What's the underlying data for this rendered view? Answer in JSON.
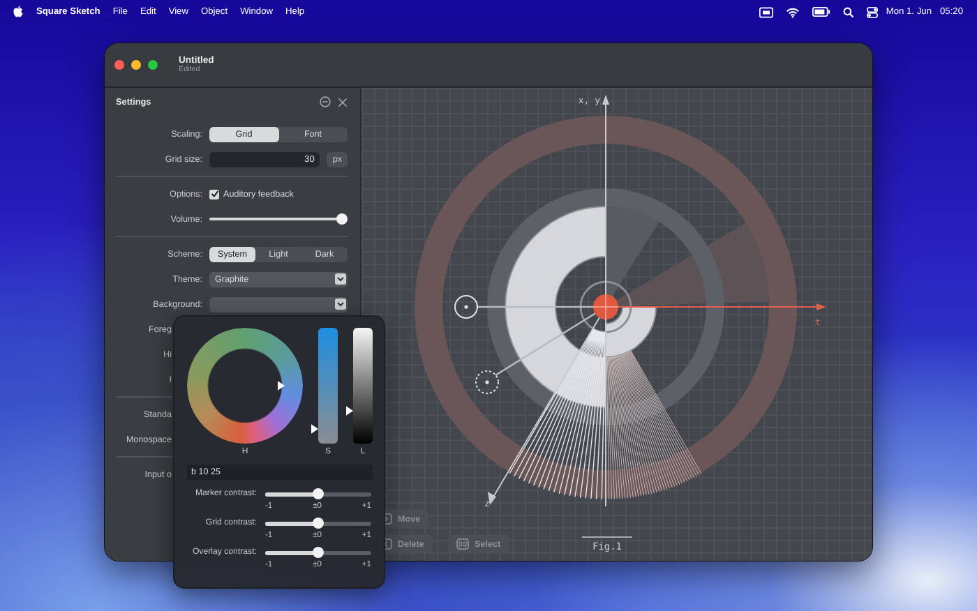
{
  "menu_bar": {
    "app_name": "Square Sketch",
    "menus": [
      "File",
      "Edit",
      "View",
      "Object",
      "Window",
      "Help"
    ],
    "date": "Mon 1. Jun",
    "time": "05:20"
  },
  "window": {
    "title": "Untitled",
    "subtitle": "Edited"
  },
  "settings": {
    "title": "Settings",
    "groups": [
      [
        {
          "kind": "segmented",
          "label": "Scaling:",
          "options": [
            {
              "label": "Grid",
              "selected": true
            },
            {
              "label": "Font",
              "selected": false
            }
          ]
        },
        {
          "kind": "number",
          "label": "Grid size:",
          "value": "30",
          "unit": "px"
        }
      ],
      [
        {
          "kind": "checkbox",
          "label": "Options:",
          "text": "Auditory feedback",
          "checked": true
        },
        {
          "kind": "slider",
          "label": "Volume:",
          "level": 1.0
        }
      ],
      [
        {
          "kind": "segmented",
          "label": "Scheme:",
          "options": [
            {
              "label": "System",
              "selected": true
            },
            {
              "label": "Light",
              "selected": false
            },
            {
              "label": "Dark",
              "selected": false
            }
          ]
        },
        {
          "kind": "popup",
          "label": "Theme:",
          "value": "Graphite"
        },
        {
          "kind": "popup",
          "label": "Background:"
        },
        {
          "kind": "cut",
          "label": "Foreg"
        },
        {
          "kind": "cut",
          "label": "Hi"
        },
        {
          "kind": "cut",
          "label": "I"
        }
      ],
      [
        {
          "kind": "cut",
          "label": "Standa"
        },
        {
          "kind": "cut",
          "label": "Monospace"
        }
      ],
      [
        {
          "kind": "cut",
          "label": "Input o"
        }
      ]
    ]
  },
  "color_picker": {
    "hue_label": "H",
    "saturation": {
      "label": "S",
      "level": 0.13
    },
    "lightness": {
      "label": "L",
      "level": 0.28
    },
    "value": "b 10 25",
    "sliders": [
      {
        "label": "Marker contrast:",
        "level": 0.5,
        "ticks": [
          "-1",
          "±0",
          "+1"
        ]
      },
      {
        "label": "Grid contrast:",
        "level": 0.5,
        "ticks": [
          "-1",
          "±0",
          "+1"
        ]
      },
      {
        "label": "Overlay contrast:",
        "level": 0.5,
        "ticks": [
          "-1",
          "±0",
          "+1"
        ]
      }
    ]
  },
  "canvas": {
    "axis_labels": {
      "vertical": "x, y",
      "t": "t",
      "z": "z"
    },
    "caption": "Fig.1",
    "tools": [
      {
        "kind": "move",
        "label": "Move"
      },
      {
        "kind": "delete",
        "label": "Delete"
      },
      {
        "kind": "select",
        "label": "Select"
      }
    ]
  }
}
